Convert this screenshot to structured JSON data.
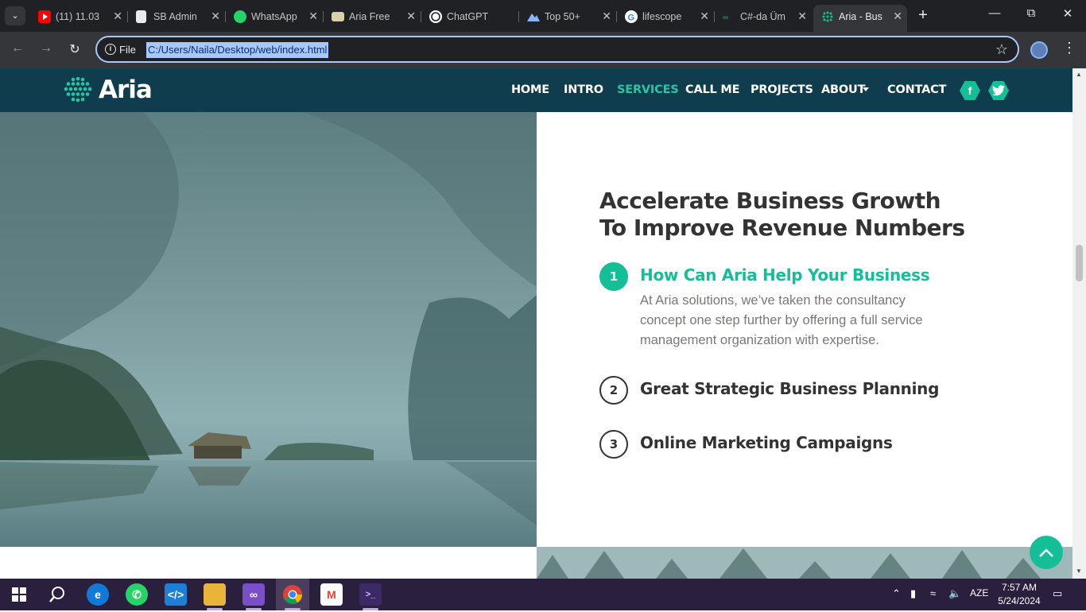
{
  "browser": {
    "tabs": [
      {
        "title": "(11) 11.03",
        "favicon": "youtube-icon",
        "active": false
      },
      {
        "title": "SB Admin",
        "favicon": "document-icon",
        "active": false
      },
      {
        "title": "WhatsApp",
        "favicon": "whatsapp-icon",
        "active": false
      },
      {
        "title": "Aria Free",
        "favicon": "template-icon",
        "active": false
      },
      {
        "title": "ChatGPT",
        "favicon": "chatgpt-icon",
        "active": false
      },
      {
        "title": "Top 50+",
        "favicon": "mountain-icon",
        "active": false
      },
      {
        "title": "lifescope",
        "favicon": "google-icon",
        "active": false
      },
      {
        "title": "C#-da Üm",
        "favicon": "geeks-icon",
        "active": false
      },
      {
        "title": "Aria - Bus",
        "favicon": "aria-icon",
        "active": true
      }
    ],
    "new_tab_label": "+",
    "omnibox": {
      "security_label": "File",
      "url": "C:/Users/Naila/Desktop/web/index.html"
    }
  },
  "site": {
    "logo_text": "Aria",
    "nav": [
      {
        "label": "HOME",
        "active": false
      },
      {
        "label": "INTRO",
        "active": false
      },
      {
        "label": "SERVICES",
        "active": true
      },
      {
        "label": "CALL ME",
        "active": false
      },
      {
        "label": "PROJECTS",
        "active": false
      },
      {
        "label": "ABOUT",
        "active": false,
        "dropdown": true
      },
      {
        "label": "CONTACT",
        "active": false
      }
    ],
    "social": [
      "facebook-icon",
      "twitter-icon"
    ],
    "section": {
      "heading_line1": "Accelerate Business Growth",
      "heading_line2": "To Improve Revenue Numbers",
      "items": [
        {
          "number": "1",
          "title": "How Can Aria Help Your Business",
          "active": true,
          "description": "At Aria solutions, we’ve taken the consultancy concept one step further by offering a full service management organization with expertise."
        },
        {
          "number": "2",
          "title": "Great Strategic Business Planning",
          "active": false
        },
        {
          "number": "3",
          "title": "Online Marketing Campaigns",
          "active": false
        }
      ]
    },
    "accent_color": "#14bf98",
    "navbar_color": "#0f3d4e"
  },
  "taskbar": {
    "apps": [
      "windows-start-icon",
      "search-icon",
      "edge-icon",
      "whatsapp-icon",
      "vscode-icon",
      "file-explorer-icon",
      "visual-studio-icon",
      "chrome-icon",
      "gmail-icon",
      "terminal-icon"
    ],
    "language": "AZE",
    "time": "7:57 AM",
    "date": "5/24/2024"
  }
}
